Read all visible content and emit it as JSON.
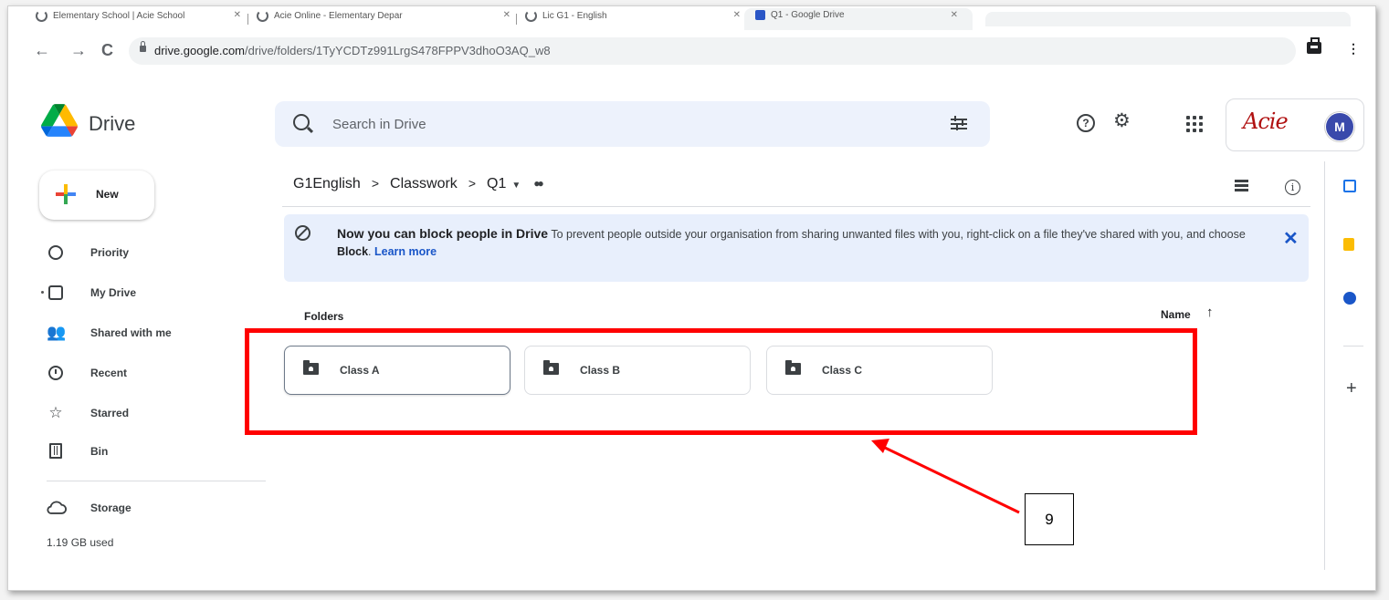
{
  "browser": {
    "tabs": [
      {
        "label": "Elementary School | Acie School"
      },
      {
        "label": "Acie Online - Elementary Depar"
      },
      {
        "label": "Lic G1 - English"
      },
      {
        "label": "Q1 - Google Drive"
      }
    ],
    "url_host": "drive.google.com",
    "url_path": "/drive/folders/1TyYCDTz991LrgS478FPPV3dhoO3AQ_w8"
  },
  "drive": {
    "brand": "Drive",
    "search_placeholder": "Search in Drive",
    "org_logo_text": "Acie",
    "avatar_initial": "M"
  },
  "sidebar": {
    "new_label": "New",
    "items": [
      {
        "label": "Priority",
        "icon": "priority-icon"
      },
      {
        "label": "My Drive",
        "icon": "my-drive-icon"
      },
      {
        "label": "Shared with me",
        "icon": "shared-icon"
      },
      {
        "label": "Recent",
        "icon": "recent-icon"
      },
      {
        "label": "Starred",
        "icon": "star-icon"
      },
      {
        "label": "Bin",
        "icon": "bin-icon"
      }
    ],
    "storage_label": "Storage",
    "storage_used": "1.19 GB used"
  },
  "breadcrumb": {
    "items": [
      "G1English",
      "Classwork",
      "Q1"
    ]
  },
  "banner": {
    "title": "Now you can block people in Drive",
    "text_before": "To prevent people outside your organisation from sharing unwanted files with you, right-click on a file they've shared with you, and choose",
    "bold": "Block",
    "text_after": ".",
    "link": "Learn more"
  },
  "folders": {
    "section_label": "Folders",
    "sort_label": "Name",
    "items": [
      {
        "name": "Class A"
      },
      {
        "name": "Class B"
      },
      {
        "name": "Class C"
      }
    ]
  },
  "annotation": {
    "callout_number": "9",
    "highlight_color": "#ff0000"
  },
  "colors": {
    "accent_blue": "#1a56c8",
    "banner_bg": "#e8effc",
    "search_bg": "#edf2fc",
    "avatar_bg": "#3949ab"
  }
}
